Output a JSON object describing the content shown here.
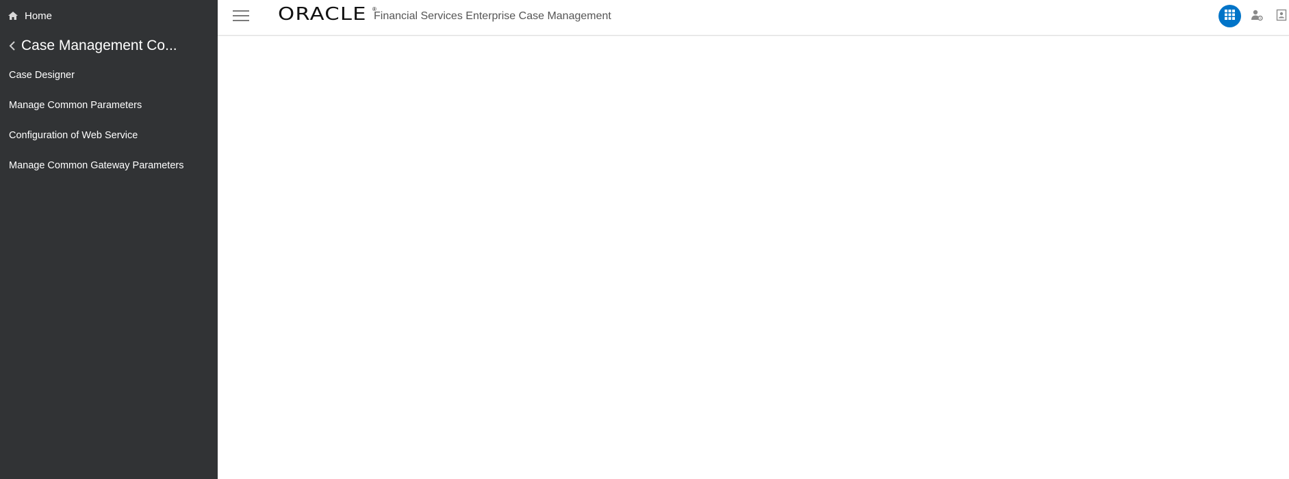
{
  "sidebar": {
    "home_label": "Home",
    "home_icon": "home-icon",
    "section_title": "Case Management Co...",
    "back_icon": "chevron-left-icon",
    "items": [
      {
        "label": "Case Designer"
      },
      {
        "label": "Manage Common Parameters"
      },
      {
        "label": "Configuration of Web Service"
      },
      {
        "label": "Manage Common Gateway Parameters"
      }
    ]
  },
  "header": {
    "menu_icon": "hamburger-menu-icon",
    "logo_text": "ORACLE",
    "logo_mark": "®",
    "app_title": "Financial Services Enterprise Case Management",
    "actions": {
      "apps_icon": "apps-grid-icon",
      "user_icon": "user-settings-icon",
      "profile_icon": "profile-card-icon"
    }
  },
  "colors": {
    "sidebar_bg": "#313335",
    "accent": "#0074c8",
    "header_bg": "#ffffff",
    "text_light": "#ffffff",
    "title_gray": "#555555"
  }
}
